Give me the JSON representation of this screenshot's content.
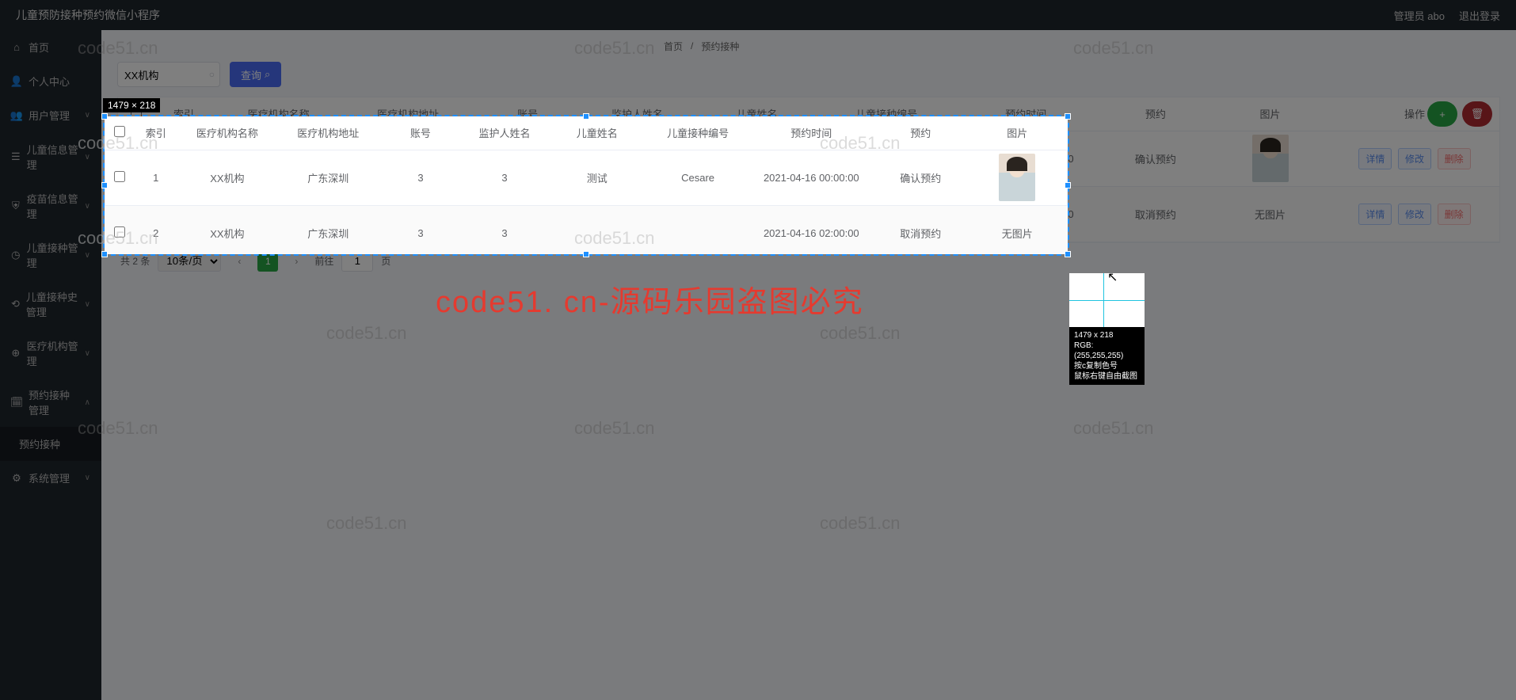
{
  "topbar": {
    "title": "儿童预防接种预约微信小程序",
    "user": "管理员 abo",
    "logout": "退出登录"
  },
  "sidebar": {
    "items": [
      {
        "icon": "home",
        "label": "首页"
      },
      {
        "icon": "user",
        "label": "个人中心"
      },
      {
        "icon": "users",
        "label": "用户管理",
        "arrow": true
      },
      {
        "icon": "list",
        "label": "儿童信息管理",
        "arrow": true
      },
      {
        "icon": "shield",
        "label": "疫苗信息管理",
        "arrow": true
      },
      {
        "icon": "clock",
        "label": "儿童接种管理",
        "arrow": true
      },
      {
        "icon": "history",
        "label": "儿童接种史管理",
        "arrow": true
      },
      {
        "icon": "hospital",
        "label": "医疗机构管理",
        "arrow": true
      },
      {
        "icon": "calendar",
        "label": "预约接种管理",
        "arrow": true,
        "expanded": true
      },
      {
        "icon": "",
        "label": "预约接种",
        "sub": true
      },
      {
        "icon": "gear",
        "label": "系统管理",
        "arrow": true
      }
    ]
  },
  "breadcrumb": {
    "home": "首页",
    "sep": "/",
    "current": "预约接种"
  },
  "search": {
    "value": "XX机构",
    "button": "查询"
  },
  "toolbar": {
    "add": "+",
    "delete": "🗑"
  },
  "table": {
    "headers": [
      "",
      "索引",
      "医疗机构名称",
      "医疗机构地址",
      "账号",
      "监护人姓名",
      "儿童姓名",
      "儿童接种编号",
      "预约时间",
      "预约",
      "图片",
      "操作"
    ],
    "rows": [
      {
        "idx": "1",
        "org": "XX机构",
        "addr": "广东深圳",
        "acct": "3",
        "guardian": "3",
        "child": "测试",
        "code": "Cesare",
        "time": "2021-04-16 00:00:00",
        "status": "确认预约",
        "img": "photo"
      },
      {
        "idx": "2",
        "org": "XX机构",
        "addr": "广东深圳",
        "acct": "3",
        "guardian": "3",
        "child": "",
        "code": "",
        "time": "2021-04-16 02:00:00",
        "status": "取消预约",
        "img": "无图片"
      }
    ],
    "actions": {
      "detail": "详情",
      "edit": "修改",
      "del": "删除"
    }
  },
  "pager": {
    "total": "共 2 条",
    "perpage": "10条/页",
    "page": "1",
    "goto": "前往",
    "gotoval": "1",
    "suffix": "页"
  },
  "selection": {
    "label": "1479 × 218"
  },
  "watermark_red": "code51. cn-源码乐园盗图必究",
  "watermark": "code51.cn",
  "magnifier": {
    "dim": "1479 x 218",
    "rgb": "RGB:(255,255,255)",
    "hint1": "按c复制色号",
    "hint2": "鼠标右键自由截图"
  }
}
